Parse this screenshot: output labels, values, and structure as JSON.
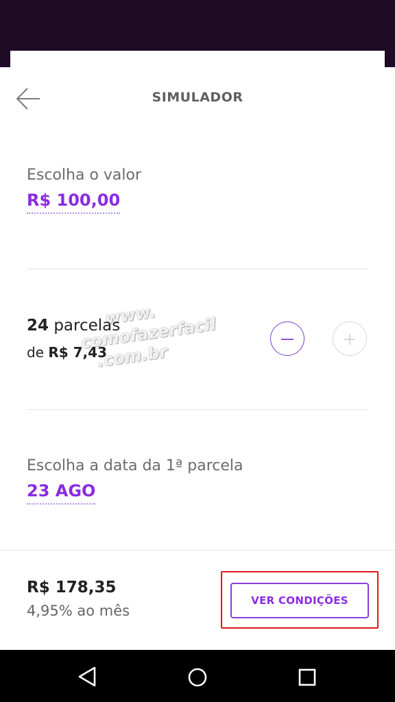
{
  "header": {
    "title": "SIMULADOR",
    "back_icon": "arrow-left-icon"
  },
  "amount": {
    "label": "Escolha o valor",
    "value": "R$ 100,00"
  },
  "installments": {
    "count": "24",
    "count_suffix": " parcelas",
    "de_prefix": "de ",
    "amount": "R$ 7,43",
    "decrement_icon": "minus-icon",
    "increment_icon": "plus-icon"
  },
  "watermark": {
    "line1": "www.",
    "line2": "comofazerfacil",
    "line3": ".com.br"
  },
  "first_date": {
    "label": "Escolha a data da 1ª parcela",
    "value": "23 AGO"
  },
  "footer": {
    "total": "R$ 178,35",
    "rate": "4,95% ao mês",
    "cta_label": "VER CONDIÇÕES"
  },
  "system_nav": {
    "back_icon": "triangle-back-icon",
    "home_icon": "circle-home-icon",
    "recents_icon": "square-recents-icon"
  },
  "colors": {
    "accent": "#8a2be2",
    "top_bar": "#1e0b26",
    "highlight_box": "#e01919"
  }
}
